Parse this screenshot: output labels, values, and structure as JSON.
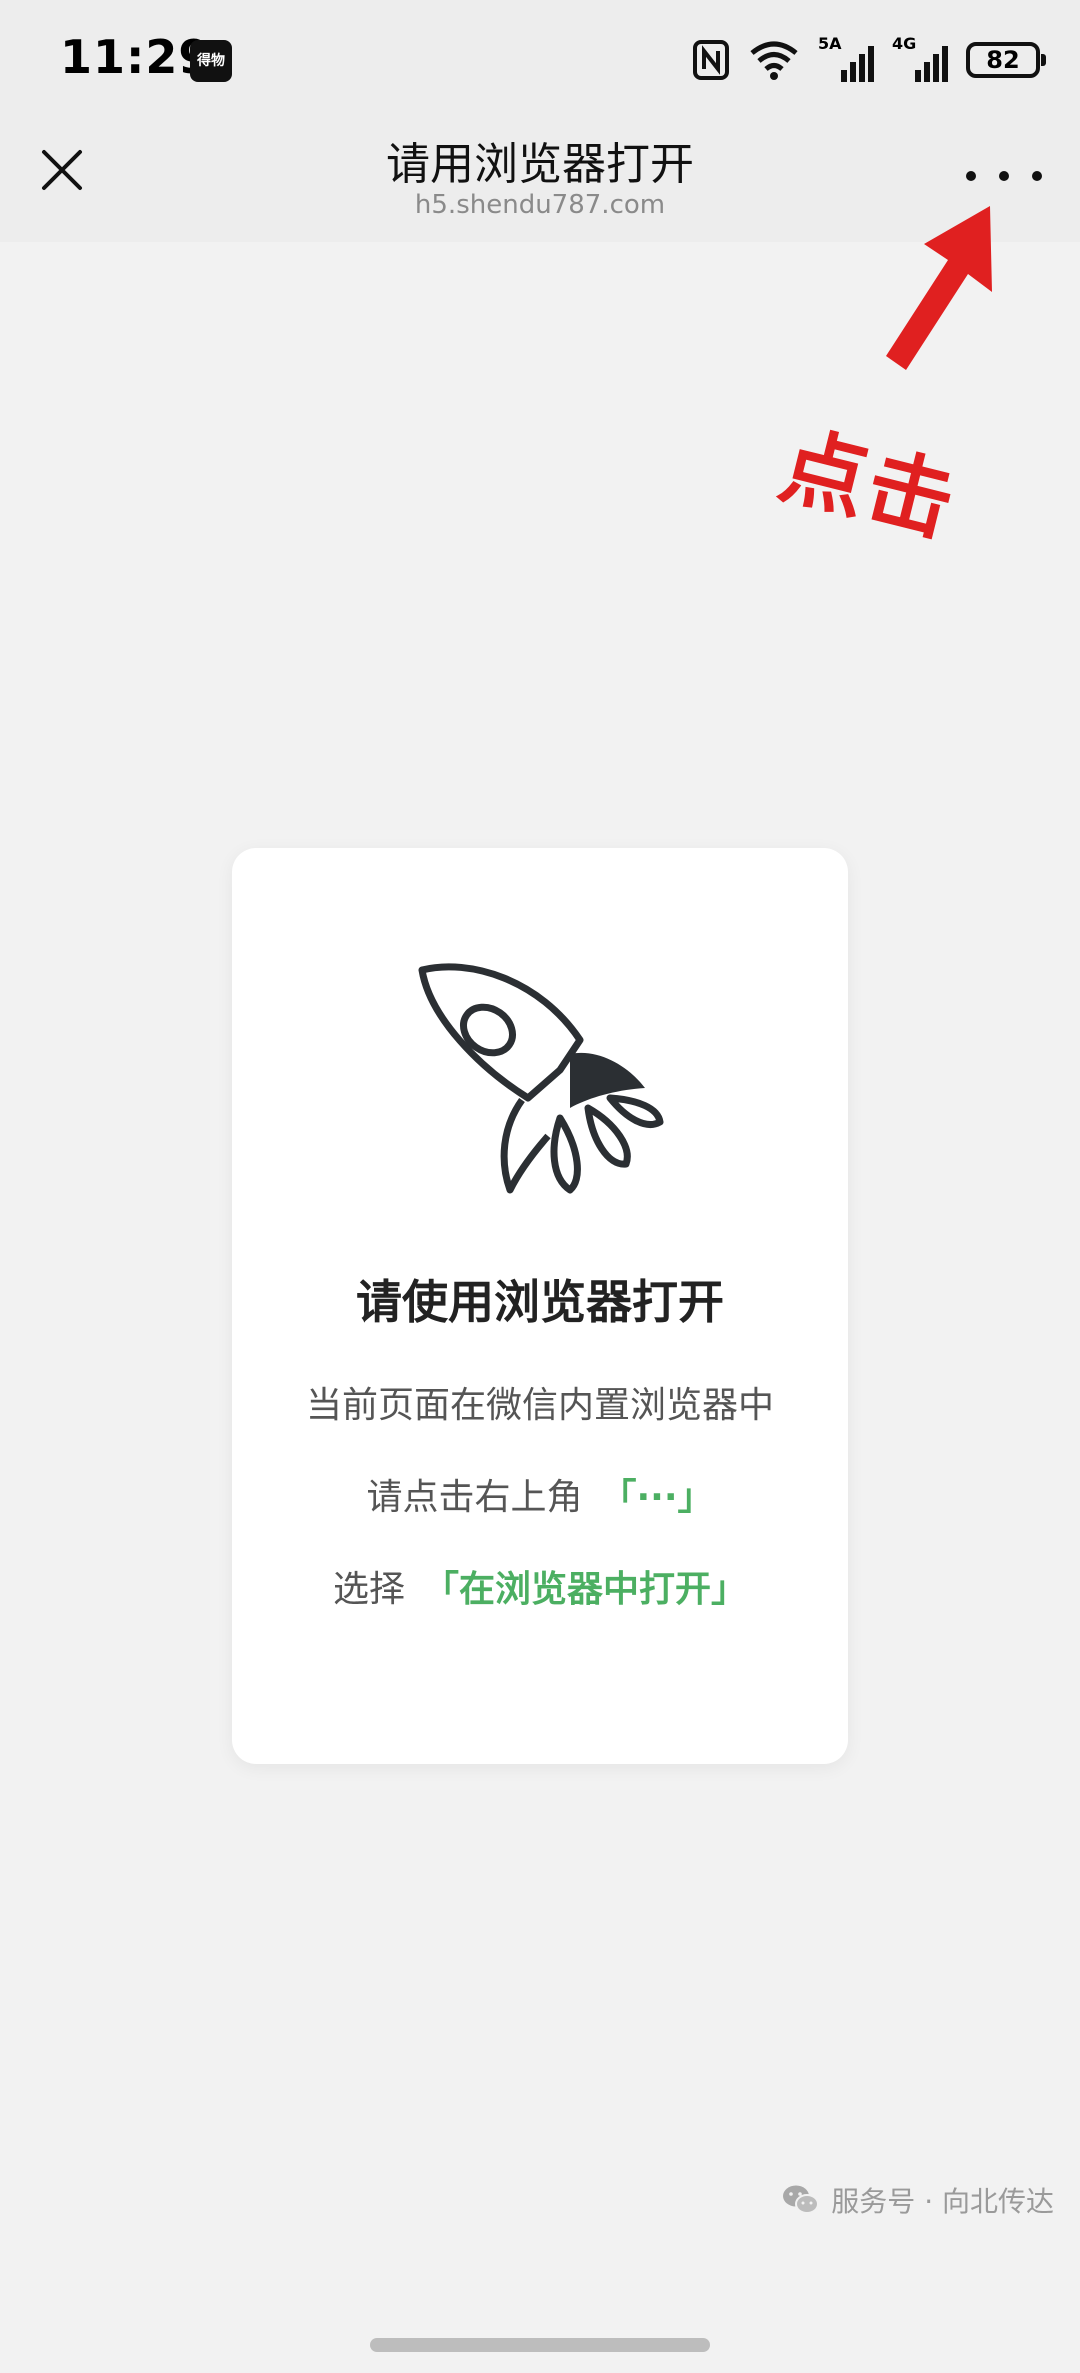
{
  "status_bar": {
    "time": "11:29",
    "app_badge": "得物",
    "signal_5a": "5A",
    "signal_4g": "4G",
    "battery": "82"
  },
  "title_bar": {
    "title": "请用浏览器打开",
    "url": "h5.shendu787.com"
  },
  "annotation": {
    "text": "点击",
    "color": "#e02020"
  },
  "card": {
    "title": "请使用浏览器打开",
    "line1": "当前页面在微信内置浏览器中",
    "line2_prefix": "请点击右上角",
    "line2_highlight": "「···」",
    "line3_prefix": "选择",
    "line3_highlight": "「在浏览器中打开」",
    "highlight_color": "#4caf62"
  },
  "watermark": {
    "text": "服务号 · 向北传达"
  }
}
